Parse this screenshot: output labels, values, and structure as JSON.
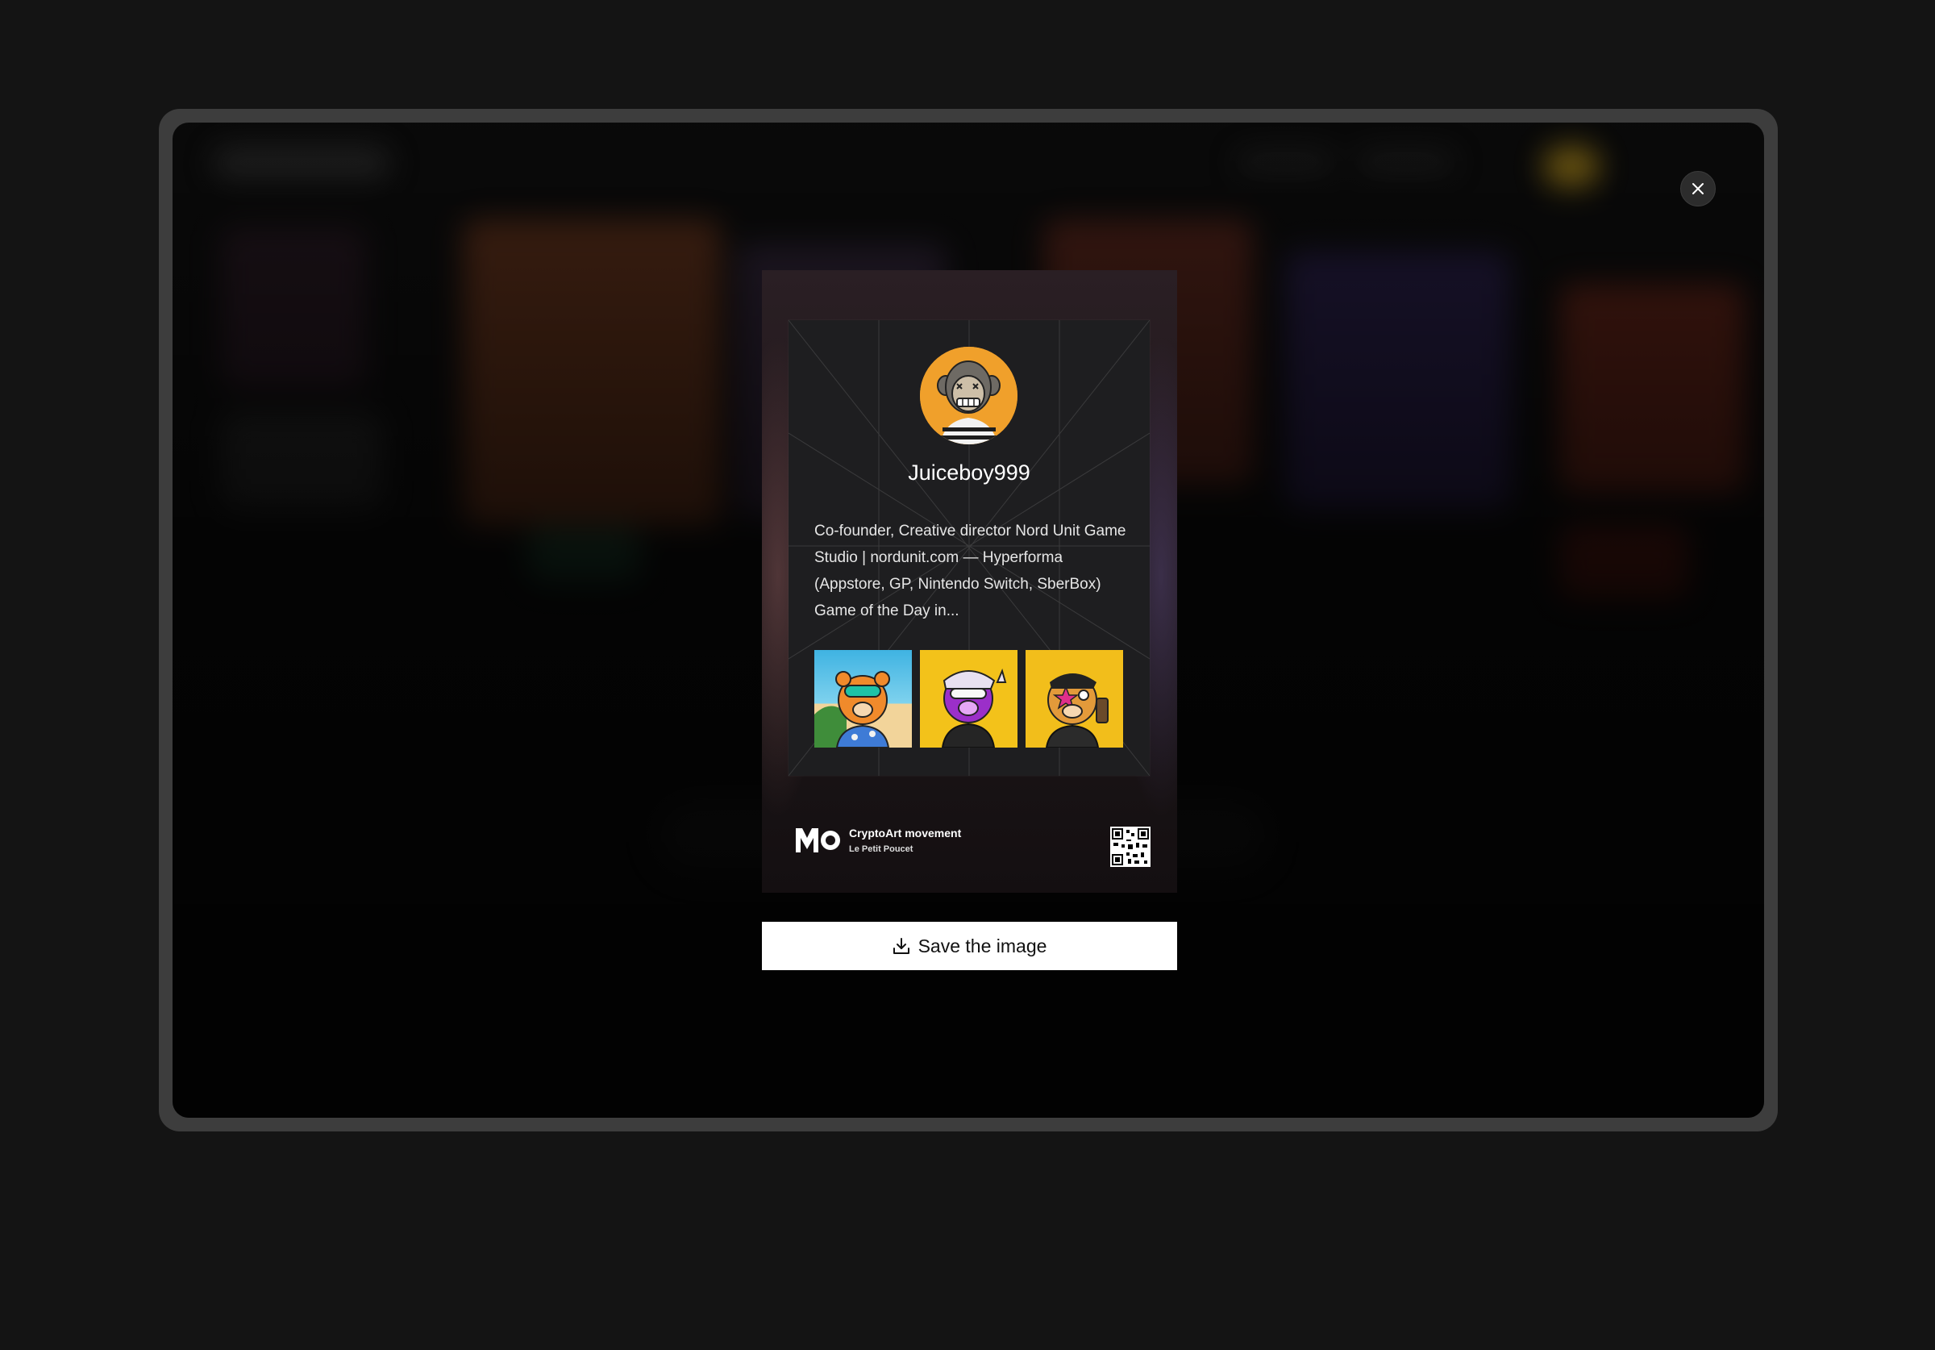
{
  "modal": {
    "close_icon": "close-icon",
    "save_icon": "download-icon",
    "save_label": "Save the image"
  },
  "profile": {
    "username": "Juiceboy999",
    "bio": "Co-founder, Creative director Nord Unit Game Studio | nordunit.com — Hyperforma (Appstore, GP, Nintendo Switch, SberBox) Game of the Day in...",
    "avatar_bg": "#f0a02b",
    "nfts": [
      {
        "name": "nft-bear-beach"
      },
      {
        "name": "nft-bear-purple"
      },
      {
        "name": "nft-bear-star"
      }
    ]
  },
  "footer": {
    "logo_icon": "mo-logo-icon",
    "brand_title": "CryptoArt movement",
    "brand_subtitle": "Le Petit Poucet",
    "qr_icon": "qr-code-icon"
  },
  "colors": {
    "page_bg": "#141414",
    "frame": "#3d3d3d",
    "button_bg": "#ffffff",
    "accent_orange": "#f0a02b",
    "accent_yellow": "#f3c21a"
  }
}
